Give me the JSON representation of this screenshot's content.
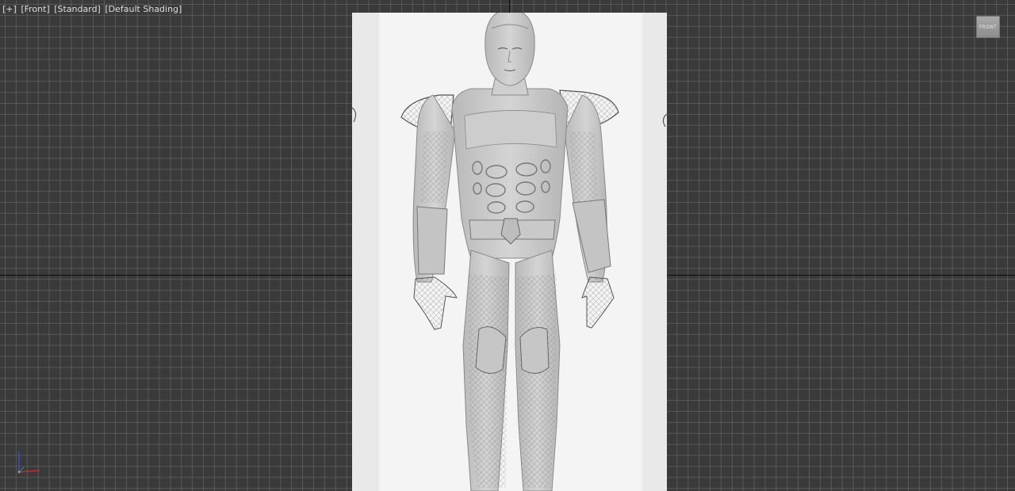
{
  "viewport": {
    "labels": {
      "plus": "[+]",
      "view": "[Front]",
      "mode": "[Standard]",
      "shading": "[Default Shading]"
    },
    "viewcube_label": "FRONT",
    "background_color": "#3a3a3a",
    "grid_color": "#6e6e6e",
    "world_axis_color": "#0d0d0d",
    "reference_image": "character-blueprint-front",
    "gizmo_colors": {
      "x": "#c03030",
      "y": "#30a030",
      "z": "#3050d0"
    }
  }
}
